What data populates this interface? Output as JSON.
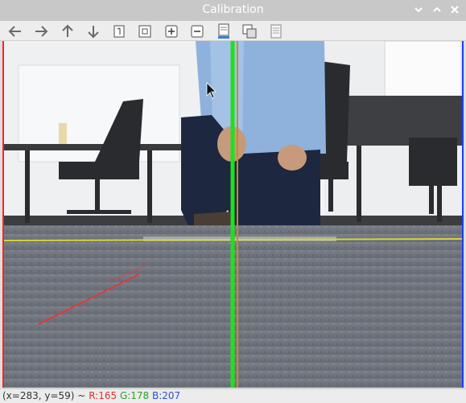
{
  "window": {
    "title": "Calibration",
    "controls": [
      "chevron-down-icon",
      "chevron-up-icon",
      "close-icon"
    ]
  },
  "toolbar": {
    "buttons": [
      {
        "icon": "arrow-left-icon"
      },
      {
        "icon": "arrow-right-icon"
      },
      {
        "icon": "arrow-up-icon"
      },
      {
        "icon": "arrow-down-icon"
      },
      {
        "icon": "zoom-original-icon"
      },
      {
        "icon": "zoom-fit-icon"
      },
      {
        "icon": "zoom-in-icon"
      },
      {
        "icon": "zoom-out-icon"
      },
      {
        "icon": "save-image-icon"
      },
      {
        "icon": "copy-image-icon"
      },
      {
        "icon": "properties-icon"
      }
    ]
  },
  "status": {
    "coords": "(x=283, y=59) ~",
    "r": "R:165",
    "g": "G:178",
    "b": "B:207"
  },
  "colors": {
    "guide_line_green": "#1fe01f",
    "guide_line_red": "#ff2020",
    "guide_line_blue": "#1f3cff",
    "floor_line_yellow": "#d6d63a"
  }
}
